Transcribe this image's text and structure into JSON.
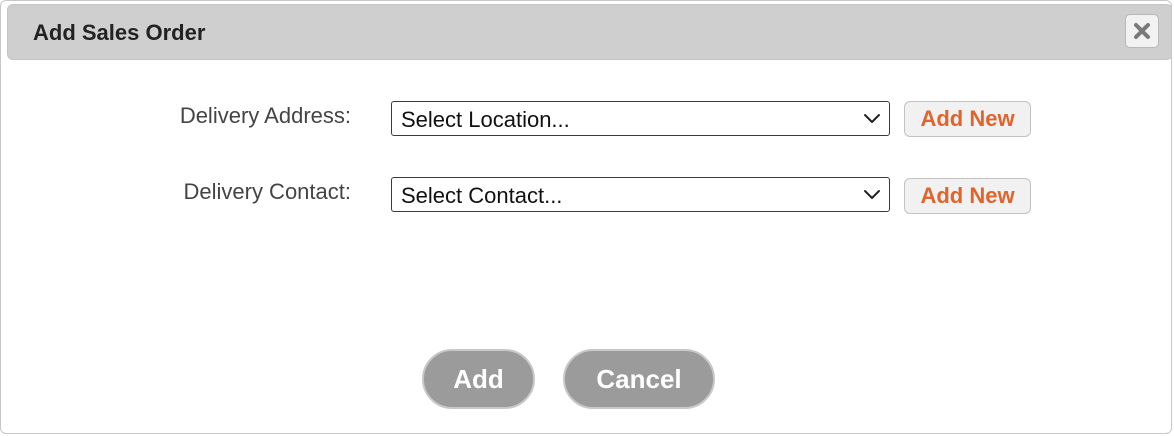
{
  "dialog": {
    "title": "Add Sales Order",
    "close_icon": "close-icon"
  },
  "form": {
    "delivery_address": {
      "label": "Delivery Address:",
      "selected": "Select Location...",
      "add_new_label": "Add New"
    },
    "delivery_contact": {
      "label": "Delivery Contact:",
      "selected": "Select Contact...",
      "add_new_label": "Add New"
    }
  },
  "footer": {
    "add_label": "Add",
    "cancel_label": "Cancel"
  },
  "colors": {
    "accent": "#e0642b",
    "button_bg": "#9b9b9b",
    "titlebar_bg": "#cfcfcf"
  }
}
